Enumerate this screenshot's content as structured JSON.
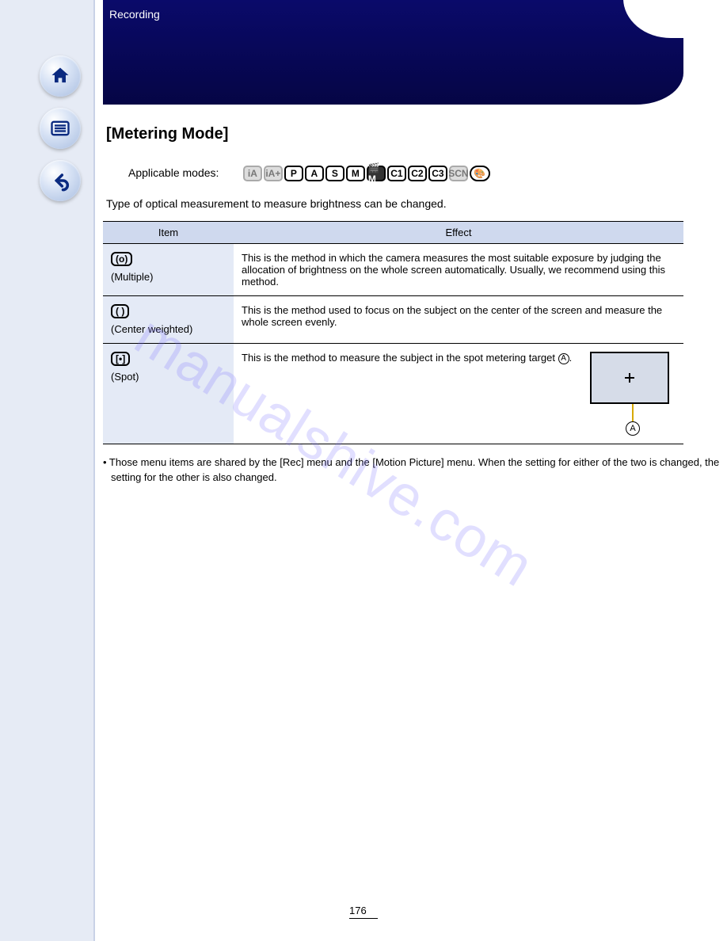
{
  "nav": {
    "home": "home-icon",
    "menu": "menu-icon",
    "back": "back-icon"
  },
  "banner": {
    "breadcrumb": "Recording"
  },
  "modes": {
    "label": "Applicable modes:",
    "chips": [
      "iA",
      "iA+",
      "P",
      "A",
      "S",
      "M",
      "🎬M",
      "C1",
      "C2",
      "C3",
      "SCN",
      "🎨"
    ]
  },
  "section_title": "[Metering Mode]",
  "intro": "Type of optical measurement to measure brightness can be changed.",
  "table": {
    "headers": [
      "Item",
      "Effect"
    ],
    "rows": [
      {
        "icon": "(o)",
        "label": "(Multiple)",
        "effect": "This is the method in which the camera measures the most suitable exposure by judging the allocation of brightness on the whole screen automatically. Usually, we recommend using this method."
      },
      {
        "icon": "( )",
        "label": "(Center weighted)",
        "effect": "This is the method used to focus on the subject on the center of the screen and measure the whole screen evenly."
      },
      {
        "icon": "[•]",
        "label": "(Spot)",
        "effect": "This is the method to measure the subject in the spot metering target ",
        "target_ref": "A",
        "effect_suffix": "."
      }
    ]
  },
  "notes": [
    "• Those menu items are shared by the [Rec] menu and the [Motion Picture] menu. When the setting for either of the two is changed, the setting for the other is also changed."
  ],
  "watermark": "manualshive.com",
  "page_number": "176"
}
